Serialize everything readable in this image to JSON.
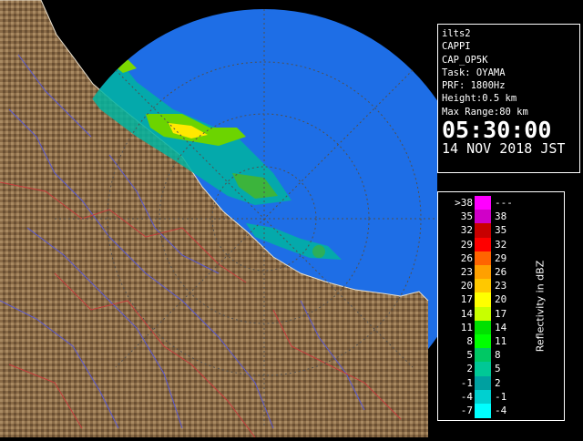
{
  "info": {
    "station": "ilts2",
    "product": "CAPPI",
    "mode": "CAP_OP5K",
    "task": "Task: OYAMA",
    "prf": "PRF: 1800Hz",
    "height": "Height:0.5 km",
    "max_range": "Max Range:80 km",
    "time": "05:30:00",
    "date": "14 NOV 2018 JST"
  },
  "legend": {
    "title": "Reflectivity in dBZ",
    "rows": [
      {
        "lo": ">38",
        "hi": "---",
        "color": "#ff00ff"
      },
      {
        "lo": "35",
        "hi": "38",
        "color": "#d000c8"
      },
      {
        "lo": "32",
        "hi": "35",
        "color": "#c80000"
      },
      {
        "lo": "29",
        "hi": "32",
        "color": "#ff0000"
      },
      {
        "lo": "26",
        "hi": "29",
        "color": "#ff6400"
      },
      {
        "lo": "23",
        "hi": "26",
        "color": "#ffa000"
      },
      {
        "lo": "20",
        "hi": "23",
        "color": "#ffc800"
      },
      {
        "lo": "17",
        "hi": "20",
        "color": "#ffff00"
      },
      {
        "lo": "14",
        "hi": "17",
        "color": "#c8ff00"
      },
      {
        "lo": "11",
        "hi": "14",
        "color": "#00e000"
      },
      {
        "lo": "8",
        "hi": "11",
        "color": "#00ff00"
      },
      {
        "lo": "5",
        "hi": "8",
        "color": "#00c864"
      },
      {
        "lo": "2",
        "hi": "5",
        "color": "#00c896"
      },
      {
        "lo": "-1",
        "hi": "2",
        "color": "#00a0a0"
      },
      {
        "lo": "-4",
        "hi": "-1",
        "color": "#00d0d0"
      },
      {
        "lo": "-7",
        "hi": "-4",
        "color": "#00ffff"
      }
    ]
  },
  "colors": {
    "range_disk": "#1e6ee6",
    "land": "#8c6a46",
    "river": "#5a5ad2",
    "boundary": "#c83c3c",
    "range_rings": "#505050"
  }
}
